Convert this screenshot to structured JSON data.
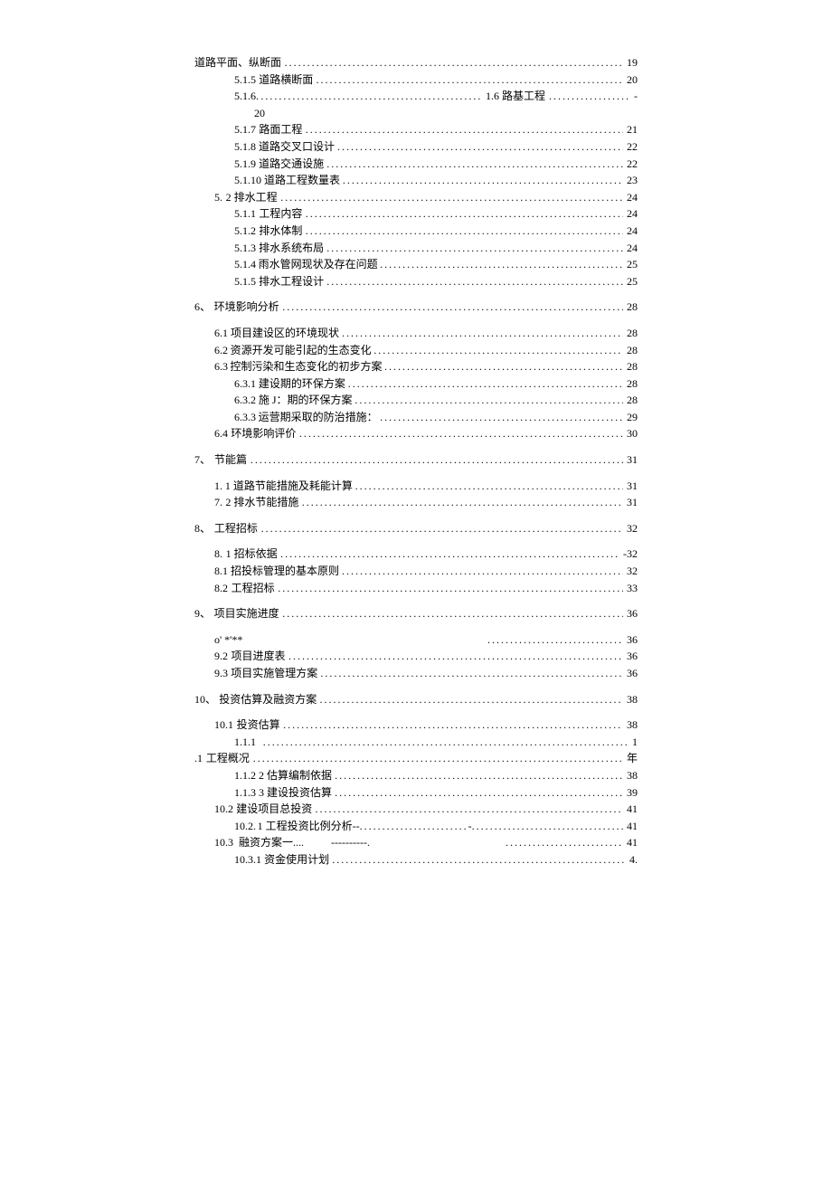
{
  "toc": [
    {
      "lvl": "lvl0i",
      "num": "",
      "label": "道路平面、纵断面",
      "page": "19"
    },
    {
      "lvl": "lvl2",
      "num": "5.1.5",
      "label": "道路横断面",
      "page": "20"
    },
    {
      "lvl": "lvl2",
      "num": "5.1.6.",
      "label": "",
      "mid": "1.6 路基工程",
      "page": "-",
      "special": "mid"
    },
    {
      "lvl": "lvl3",
      "num": "",
      "label": "20",
      "nopage": true
    },
    {
      "lvl": "lvl2",
      "num": "5.1.7",
      "label": "路面工程",
      "page": "21"
    },
    {
      "lvl": "lvl2",
      "num": "5.1.8",
      "label": "道路交叉口设计",
      "page": "22"
    },
    {
      "lvl": "lvl2",
      "num": "5.1.9",
      "label": "道路交通设施",
      "page": "22"
    },
    {
      "lvl": "lvl2",
      "num": "5.1.10",
      "label": "道路工程数量表",
      "page": "23"
    },
    {
      "lvl": "lvl1",
      "num": "5.",
      "label": "2 排水工程",
      "page": "24"
    },
    {
      "lvl": "lvl2",
      "num": "5.1.1",
      "label": "工程内容",
      "page": "24"
    },
    {
      "lvl": "lvl2",
      "num": "5.1.2",
      "label": "排水体制",
      "page": "24"
    },
    {
      "lvl": "lvl2",
      "num": "5.1.3",
      "label": "排水系统布局",
      "page": "24"
    },
    {
      "lvl": "lvl2",
      "num": "5.1.4",
      "label": "雨水管网现状及存在问题",
      "page": "25"
    },
    {
      "lvl": "lvl2",
      "num": "5.1.5",
      "label": "排水工程设计",
      "page": "25"
    },
    {
      "lvl": "lvl0",
      "num": "6、",
      "label": "环境影响分析",
      "page": "28",
      "gap": true
    },
    {
      "lvl": "lvl1",
      "num": "6.1",
      "label": "项目建设区的环境现状",
      "page": "28",
      "gap": true
    },
    {
      "lvl": "lvl1",
      "num": "6.2",
      "label": "资源开发可能引起的生态变化",
      "page": "28"
    },
    {
      "lvl": "lvl1",
      "num": "6.3",
      "label": "控制污染和生态变化的初步方案",
      "page": "28"
    },
    {
      "lvl": "lvl2",
      "num": "6.3.1",
      "label": "建设期的环保方案",
      "page": "28"
    },
    {
      "lvl": "lvl2",
      "num": "6.3.2",
      "label": "施 J：期的环保方案",
      "page": "28"
    },
    {
      "lvl": "lvl2",
      "num": "6.3.3",
      "label": "运营期采取的防治措施：",
      "page": "29"
    },
    {
      "lvl": "lvl1",
      "num": "6.4",
      "label": "环境影响评价",
      "page": "30"
    },
    {
      "lvl": "lvl0",
      "num": "7、",
      "label": "节能篇",
      "page": "31",
      "gap": true
    },
    {
      "lvl": "lvl1",
      "num": "1.",
      "label": "1 道路节能措施及耗能计算",
      "page": "31",
      "gap": true
    },
    {
      "lvl": "lvl1",
      "num": "7.",
      "label": "2 排水节能措施",
      "page": "31"
    },
    {
      "lvl": "lvl0",
      "num": "8、",
      "label": "工程招标",
      "page": "32",
      "gap": true
    },
    {
      "lvl": "lvl1",
      "num": "8.",
      "label": "1 招标依据",
      "page": "-32",
      "gap": true
    },
    {
      "lvl": "lvl1",
      "num": "8.1",
      "label": "招投标管理的基本原则",
      "page": "32"
    },
    {
      "lvl": "lvl1",
      "num": "8.2",
      "label": "工程招标",
      "page": "33"
    },
    {
      "lvl": "lvl0",
      "num": "9、",
      "label": "项目实施进度",
      "page": "36",
      "gap": true
    },
    {
      "lvl": "lvl1",
      "num": "",
      "label": "o' *'**",
      "page": "36",
      "gap": true,
      "special": "stars"
    },
    {
      "lvl": "lvl1",
      "num": "9.2",
      "label": "项目进度表",
      "page": "36"
    },
    {
      "lvl": "lvl1",
      "num": "9.3",
      "label": "项目实施管理方案",
      "page": "36"
    },
    {
      "lvl": "lvl0",
      "num": "10、",
      "label": "投资估算及融资方案",
      "page": "38",
      "gap": true
    },
    {
      "lvl": "lvl1",
      "num": "10.1",
      "label": "投资估算",
      "page": "38",
      "gap": true
    },
    {
      "lvl": "lvl2",
      "num": "1.1.1",
      "label": "",
      "page": "1"
    },
    {
      "lvl": "lvl0",
      "num": ".1",
      "label": "工程概况",
      "page": "年"
    },
    {
      "lvl": "lvl2",
      "num": "1.1.2 2",
      "label": "估算编制依据",
      "page": "38"
    },
    {
      "lvl": "lvl2",
      "num": "1.1.3 3",
      "label": "建设投资估算",
      "page": "39"
    },
    {
      "lvl": "lvl1",
      "num": "10.2",
      "label": "建设项目总投资",
      "page": "41"
    },
    {
      "lvl": "lvl2",
      "num": "10.2.",
      "label": "1 工程投资比例分析--",
      "page": "41",
      "special": "dash1"
    },
    {
      "lvl": "lvl1",
      "num": "10.3",
      "label": "融资方案一....",
      "page": "41",
      "special": "dash2"
    },
    {
      "lvl": "lvl2",
      "num": "10.3.1",
      "label": "资金使用计划",
      "page": "4."
    }
  ]
}
